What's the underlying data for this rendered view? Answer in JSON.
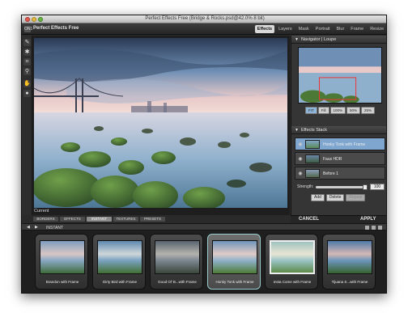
{
  "window": {
    "title": "Perfect Effects Free (Bridge & Rocks.psd@42.0% 8 bit)",
    "app_name": "Perfect Effects Free",
    "app_logo": "ON1"
  },
  "module_tabs": [
    {
      "label": "Effects",
      "active": true
    },
    {
      "label": "Layers",
      "active": false
    },
    {
      "label": "Mask",
      "active": false
    },
    {
      "label": "Portrait",
      "active": false
    },
    {
      "label": "Blur",
      "active": false
    },
    {
      "label": "Frame",
      "active": false
    },
    {
      "label": "Resize",
      "active": false
    }
  ],
  "tools": [
    {
      "icon": "brush-icon",
      "glyph": "✎"
    },
    {
      "icon": "masking-bug-icon",
      "glyph": "✱"
    },
    {
      "icon": "crop-icon",
      "glyph": "⌗"
    },
    {
      "icon": "zoom-icon",
      "glyph": "⚲"
    },
    {
      "icon": "hand-icon",
      "glyph": "✋"
    },
    {
      "icon": "info-icon",
      "glyph": "●"
    }
  ],
  "canvas": {
    "view_label": "Current"
  },
  "navigator": {
    "title": "Navigator | Loupe",
    "zoom_buttons": [
      {
        "label": "FIT",
        "active": true
      },
      {
        "label": "Fill",
        "active": false
      },
      {
        "label": "100%",
        "active": false
      },
      {
        "label": "50%",
        "active": false
      },
      {
        "label": "25%",
        "active": false
      }
    ]
  },
  "effects_stack": {
    "title": "Effects Stack",
    "items": [
      {
        "label": "Honky Tonk with Frame",
        "selected": true
      },
      {
        "label": "Faux HDR",
        "selected": false
      },
      {
        "label": "Before 1",
        "selected": false
      }
    ],
    "strength_label": "Strength:",
    "strength_value": "100",
    "strength_fraction": 0.95,
    "buttons": [
      {
        "label": "Add",
        "enabled": true
      },
      {
        "label": "Delete",
        "enabled": true
      },
      {
        "label": "Repeat",
        "enabled": false
      }
    ]
  },
  "actions": {
    "cancel": "CANCEL",
    "apply": "APPLY"
  },
  "bottom_tabs": [
    {
      "label": "BORDERS",
      "active": false
    },
    {
      "label": "EFFECTS",
      "active": false
    },
    {
      "label": "INSTANT",
      "active": true
    },
    {
      "label": "TEXTURES",
      "active": false
    },
    {
      "label": "PRESETS",
      "active": false
    }
  ],
  "browser": {
    "path": "INSTANT"
  },
  "presets": [
    {
      "label": "Brandon with Frame",
      "selected": false
    },
    {
      "label": "Dirty Bird with Frame",
      "selected": false
    },
    {
      "label": "Good Ol' B...with Frame",
      "selected": false
    },
    {
      "label": "Honky Tonk with Frame",
      "selected": true
    },
    {
      "label": "Insta Come with Frame",
      "selected": false
    },
    {
      "label": "Tijuana S...with Frame",
      "selected": false
    }
  ],
  "colors": {
    "accent": "#7ea6cf",
    "panel_bg": "#353535",
    "window_bg": "#2b2b2b"
  }
}
